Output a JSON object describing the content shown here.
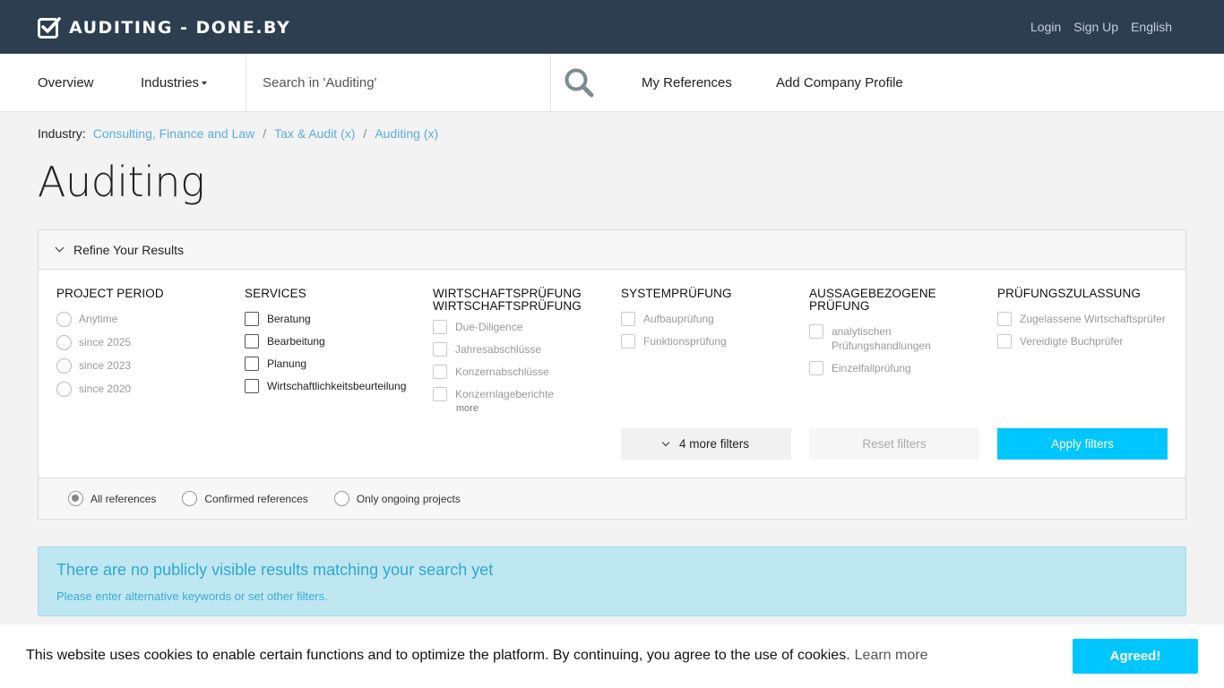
{
  "header": {
    "brand": "AUDITING - DONE.BY",
    "links": [
      "Login",
      "Sign Up",
      "English"
    ]
  },
  "nav": {
    "overview": "Overview",
    "industries": "Industries",
    "search_placeholder": "Search in 'Auditing'",
    "my_references": "My References",
    "add_company_profile": "Add Company Profile"
  },
  "breadcrumb": {
    "label": "Industry:",
    "items": [
      "Consulting, Finance and Law",
      "Tax & Audit (x)",
      "Auditing (x)"
    ],
    "separator": "/"
  },
  "page_title": "Auditing",
  "filters": {
    "toggle_label": "Refine Your Results",
    "columns": [
      {
        "title": "PROJECT PERIOD",
        "type": "radio",
        "options": [
          "Anytime",
          "since 2025",
          "since 2023",
          "since 2020"
        ],
        "enabled": false
      },
      {
        "title": "SERVICES",
        "type": "checkbox",
        "options": [
          "Beratung",
          "Bearbeitung",
          "Planung",
          "Wirtschaftlichkeitsbeurteilung"
        ],
        "enabled": true
      },
      {
        "title": "WIRTSCHAFTSPRÜFUNG WIRTSCHAFTSPRÜFUNG",
        "type": "checkbox",
        "options": [
          "Due-Diligence",
          "Jahresabschlüsse",
          "Konzernabschlüsse",
          "Konzernlageberichte"
        ],
        "enabled": false,
        "more": "more"
      },
      {
        "title": "SYSTEMPRÜFUNG",
        "type": "checkbox",
        "options": [
          "Aufbauprüfung",
          "Funktionsprüfung"
        ],
        "enabled": false
      },
      {
        "title": "AUSSAGEBEZOGENE PRÜFUNG",
        "type": "checkbox",
        "options": [
          "analytischen Prüfungshandlungen",
          "Einzelfallprüfung"
        ],
        "enabled": false
      },
      {
        "title": "PRÜFUNGSZULASSUNG",
        "type": "checkbox",
        "options": [
          "Zugelassene Wirtschaftsprüfer",
          "Vereidigte Buchprüfer"
        ],
        "enabled": false
      }
    ],
    "more_filters": "4 more filters",
    "reset": "Reset filters",
    "apply": "Apply filters",
    "scope": {
      "options": [
        "All references",
        "Confirmed references",
        "Only ongoing projects"
      ],
      "selected": "All references"
    }
  },
  "alert": {
    "title": "There are no publicly visible results matching your search yet",
    "text": "Please enter alternative keywords or set other filters."
  },
  "cookie": {
    "text": "This website uses cookies to enable certain functions and to optimize the platform. By continuing, you agree to the use of cookies.",
    "learn_more": "Learn more",
    "button": "Agreed!"
  },
  "colors": {
    "header_bg": "#2c3e50",
    "accent": "#00c6ff",
    "link": "#5aaee0",
    "alert_bg": "#bfe7f2"
  }
}
